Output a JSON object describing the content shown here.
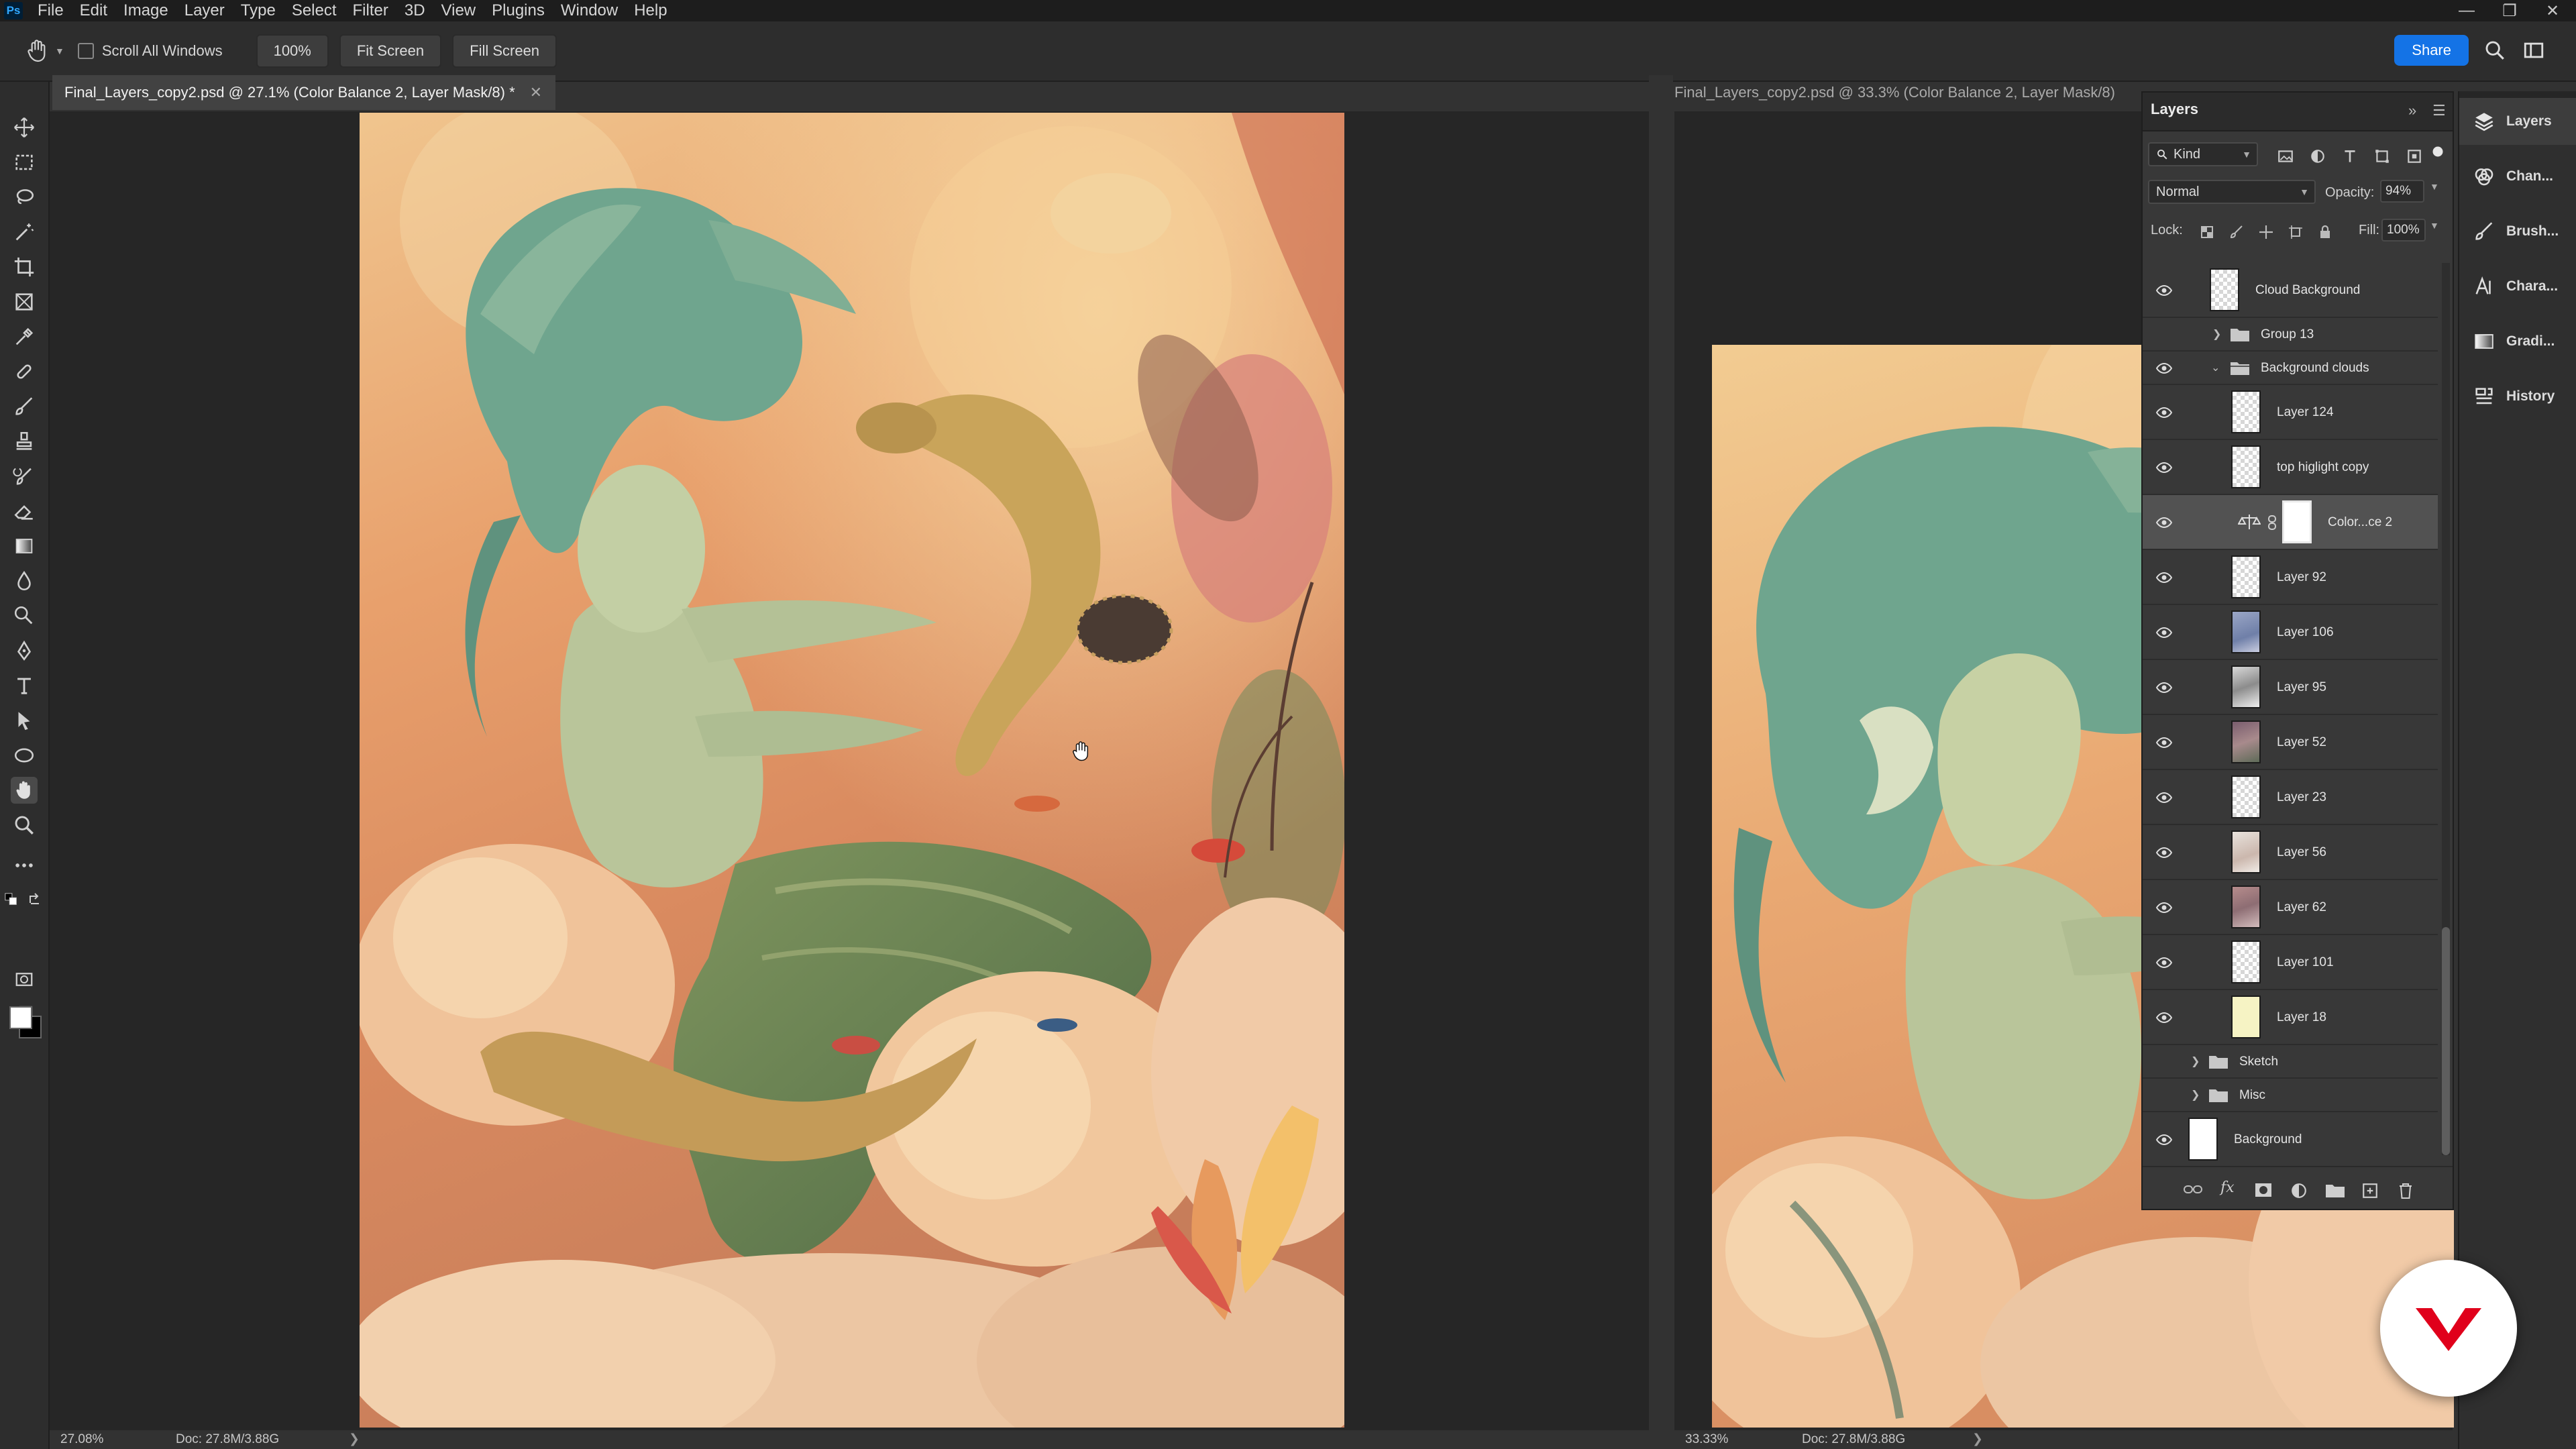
{
  "menubar": {
    "app_icon": "ps-logo",
    "items": [
      "File",
      "Edit",
      "Image",
      "Layer",
      "Type",
      "Select",
      "Filter",
      "3D",
      "View",
      "Plugins",
      "Window",
      "Help"
    ],
    "window_controls": [
      "minimize-icon",
      "restore-icon",
      "close-icon"
    ]
  },
  "options_bar": {
    "scroll_all_windows": {
      "label": "Scroll All Windows",
      "checked": false
    },
    "zoom_button": "100%",
    "fit_screen": "Fit Screen",
    "fill_screen": "Fill Screen",
    "share": "Share"
  },
  "tools": [
    "move-icon",
    "marquee-icon",
    "lasso-icon",
    "magic-wand-icon",
    "crop-icon",
    "frame-icon",
    "eyedropper-icon",
    "healing-brush-icon",
    "brush-icon",
    "clone-stamp-icon",
    "history-brush-icon",
    "eraser-icon",
    "gradient-icon",
    "blur-icon",
    "dodge-icon",
    "pen-icon",
    "type-icon",
    "path-selection-icon",
    "ellipse-icon",
    "hand-icon",
    "zoom-icon",
    "more-tools-icon"
  ],
  "colors": {
    "foreground": "#ffffff",
    "background": "#000000",
    "accent": "#1473e6",
    "panel": "#383838",
    "selected_row": "#525252"
  },
  "documents": [
    {
      "tab_title": "Final_Layers_copy2.psd @ 27.1% (Color Balance 2, Layer Mask/8) *",
      "zoom_status": "27.08%",
      "doc_status": "Doc: 27.8M/3.88G",
      "active": true
    },
    {
      "tab_title": "Final_Layers_copy2.psd @ 33.3% (Color Balance 2, Layer Mask/8)",
      "zoom_status": "33.33%",
      "doc_status": "Doc: 27.8M/3.88G",
      "active": false
    }
  ],
  "layers_panel": {
    "title": "Layers",
    "filter_kind": "Kind",
    "blend_mode": "Normal",
    "opacity_label": "Opacity:",
    "opacity": "94%",
    "lock_label": "Lock:",
    "fill_label": "Fill:",
    "fill": "100%",
    "layers": [
      {
        "name": "Cloud Background",
        "visible": true,
        "type": "pixel"
      },
      {
        "name": "Group 13",
        "visible": false,
        "type": "group",
        "expanded": false
      },
      {
        "name": "Background clouds",
        "visible": true,
        "type": "group",
        "expanded": true
      },
      {
        "name": "Layer 124",
        "visible": true,
        "type": "pixel"
      },
      {
        "name": "top higlight copy",
        "visible": true,
        "type": "pixel"
      },
      {
        "name": "Color...ce 2",
        "visible": true,
        "type": "adjustment",
        "selected": true
      },
      {
        "name": "Layer 92",
        "visible": true,
        "type": "pixel"
      },
      {
        "name": "Layer 106",
        "visible": true,
        "type": "pixel"
      },
      {
        "name": "Layer 95",
        "visible": true,
        "type": "pixel"
      },
      {
        "name": "Layer 52",
        "visible": true,
        "type": "pixel"
      },
      {
        "name": "Layer 23",
        "visible": true,
        "type": "pixel"
      },
      {
        "name": "Layer 56",
        "visible": true,
        "type": "pixel"
      },
      {
        "name": "Layer 62",
        "visible": true,
        "type": "pixel"
      },
      {
        "name": "Layer 101",
        "visible": true,
        "type": "pixel"
      },
      {
        "name": "Layer 18",
        "visible": true,
        "type": "pixel"
      },
      {
        "name": "Sketch",
        "visible": false,
        "type": "group",
        "expanded": false
      },
      {
        "name": "Misc",
        "visible": false,
        "type": "group",
        "expanded": false
      },
      {
        "name": "Background",
        "visible": true,
        "type": "background"
      }
    ],
    "footer_icons": [
      "link-layers-icon",
      "fx-icon",
      "add-mask-icon",
      "adjustment-layer-icon",
      "new-group-icon",
      "new-layer-icon",
      "delete-icon"
    ]
  },
  "right_dock": [
    {
      "label": "Layers",
      "icon": "layers-icon"
    },
    {
      "label": "Chan...",
      "icon": "channels-icon"
    },
    {
      "label": "Brush...",
      "icon": "brush-settings-icon"
    },
    {
      "label": "Chara...",
      "icon": "character-icon"
    },
    {
      "label": "Gradi...",
      "icon": "gradients-icon"
    },
    {
      "label": "History",
      "icon": "history-icon"
    }
  ]
}
